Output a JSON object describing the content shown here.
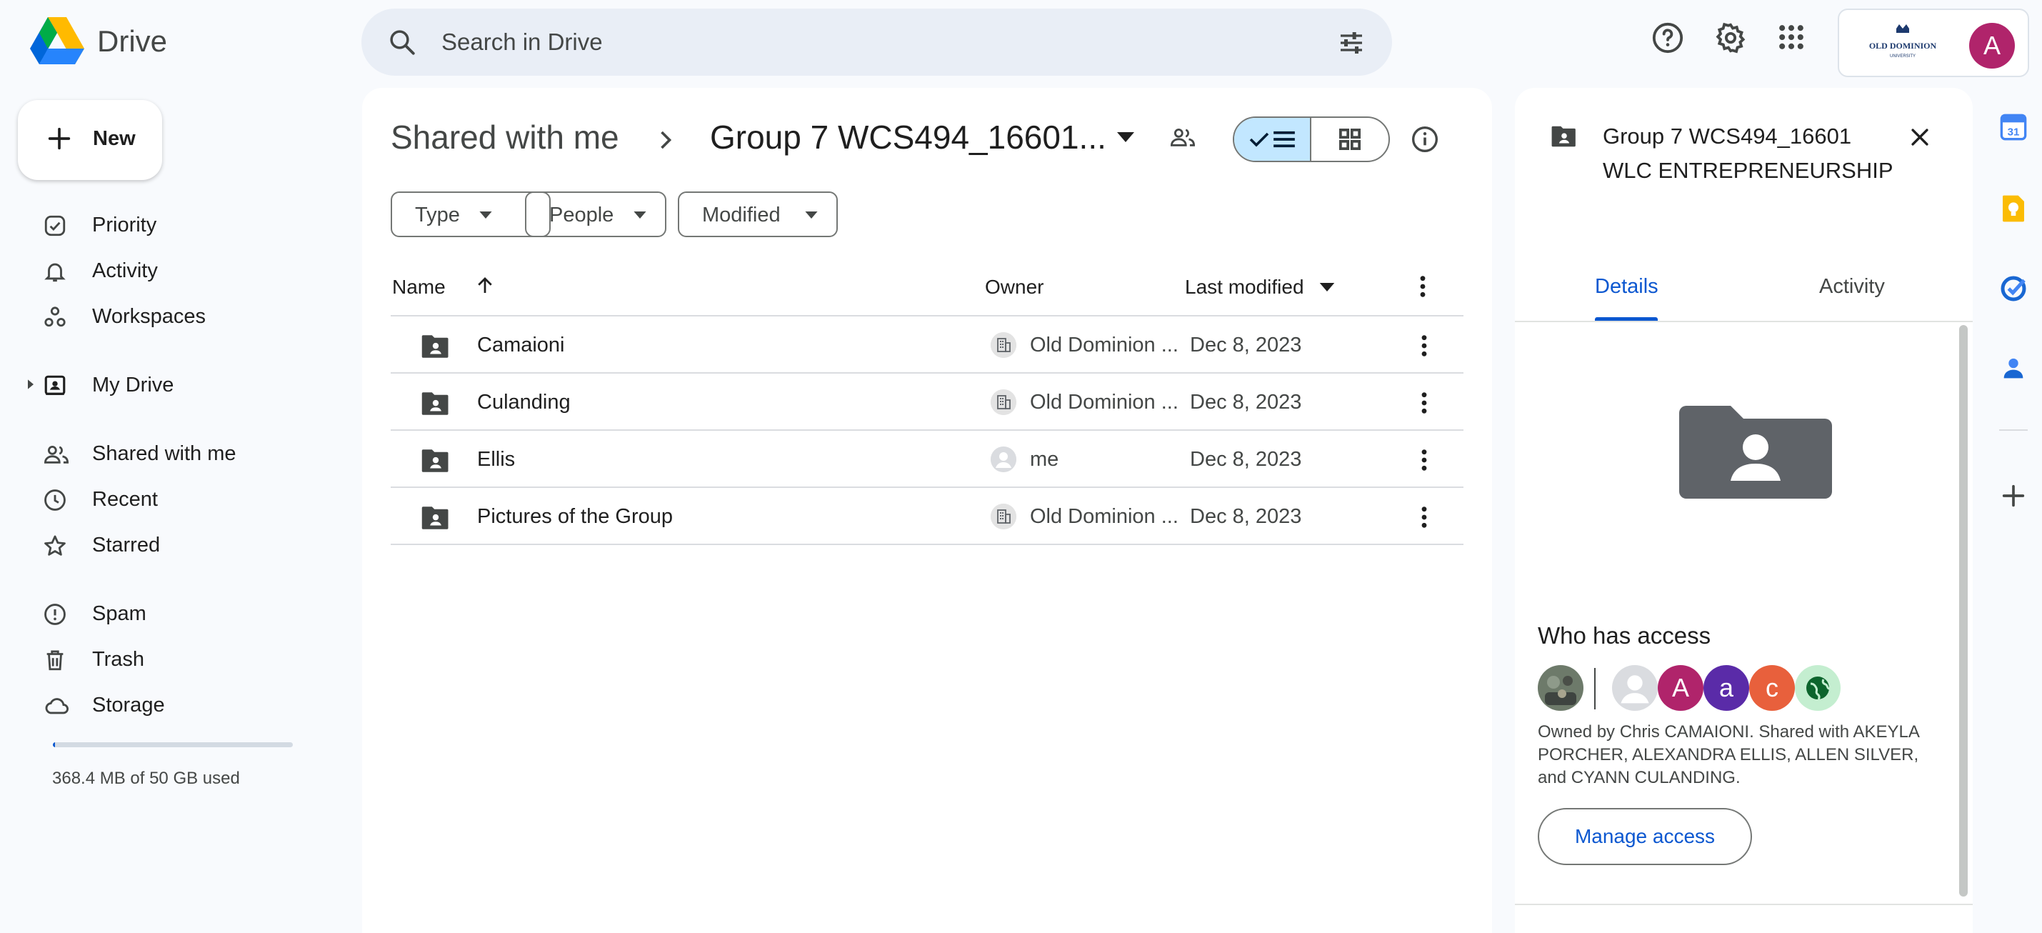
{
  "app": {
    "name": "Drive"
  },
  "search": {
    "placeholder": "Search in Drive"
  },
  "account": {
    "avatar_letter": "A",
    "org": "OLD DOMINION"
  },
  "sidebar": {
    "new_label": "New",
    "items": [
      {
        "label": "Priority",
        "icon": "priority-icon"
      },
      {
        "label": "Activity",
        "icon": "bell-icon"
      },
      {
        "label": "Workspaces",
        "icon": "workspaces-icon"
      },
      {
        "label": "My Drive",
        "icon": "my-drive-icon"
      },
      {
        "label": "Shared with me",
        "icon": "people-icon"
      },
      {
        "label": "Recent",
        "icon": "clock-icon"
      },
      {
        "label": "Starred",
        "icon": "star-icon"
      },
      {
        "label": "Spam",
        "icon": "spam-icon"
      },
      {
        "label": "Trash",
        "icon": "trash-icon"
      },
      {
        "label": "Storage",
        "icon": "cloud-icon"
      }
    ],
    "storage": {
      "text": "368.4 MB of 50 GB used",
      "fraction": 0.0072
    }
  },
  "main": {
    "breadcrumb": {
      "root": "Shared with me",
      "folder": "Group 7 WCS494_16601..."
    },
    "filters": [
      "Type",
      "People",
      "Modified"
    ],
    "columns": {
      "name": "Name",
      "owner": "Owner",
      "modified": "Last modified"
    },
    "rows": [
      {
        "name": "Camaioni",
        "owner": "Old Dominion ...",
        "modified": "Dec 8, 2023",
        "owner_type": "org"
      },
      {
        "name": "Culanding",
        "owner": "Old Dominion ...",
        "modified": "Dec 8, 2023",
        "owner_type": "org"
      },
      {
        "name": "Ellis",
        "owner": "me",
        "modified": "Dec 8, 2023",
        "owner_type": "me"
      },
      {
        "name": "Pictures of the Group",
        "owner": "Old Dominion ...",
        "modified": "Dec 8, 2023",
        "owner_type": "org"
      }
    ]
  },
  "details": {
    "title": "Group 7 WCS494_16601 WLC ENTREPRENEURSHIP",
    "tabs": [
      "Details",
      "Activity"
    ],
    "who_has_access": "Who has access",
    "avatars": [
      {
        "letter": "",
        "color": "#6d7a6a"
      },
      {
        "letter": "",
        "color": "#dadce0"
      },
      {
        "letter": "A",
        "color": "#b0246b"
      },
      {
        "letter": "a",
        "color": "#5a2ba8"
      },
      {
        "letter": "c",
        "color": "#e8603c"
      },
      {
        "letter": "",
        "color": "#c4eed0"
      }
    ],
    "owned_text": "Owned by Chris CAMAIONI. Shared with AKEYLA PORCHER, ALEXANDRA ELLIS, ALLEN SILVER, and CYANN CULANDING.",
    "manage_label": "Manage access"
  },
  "rail_calendar_day": "31",
  "colors": {
    "accent": "#0b57d0",
    "selected": "#c2e7ff",
    "background": "#f8fafd"
  }
}
